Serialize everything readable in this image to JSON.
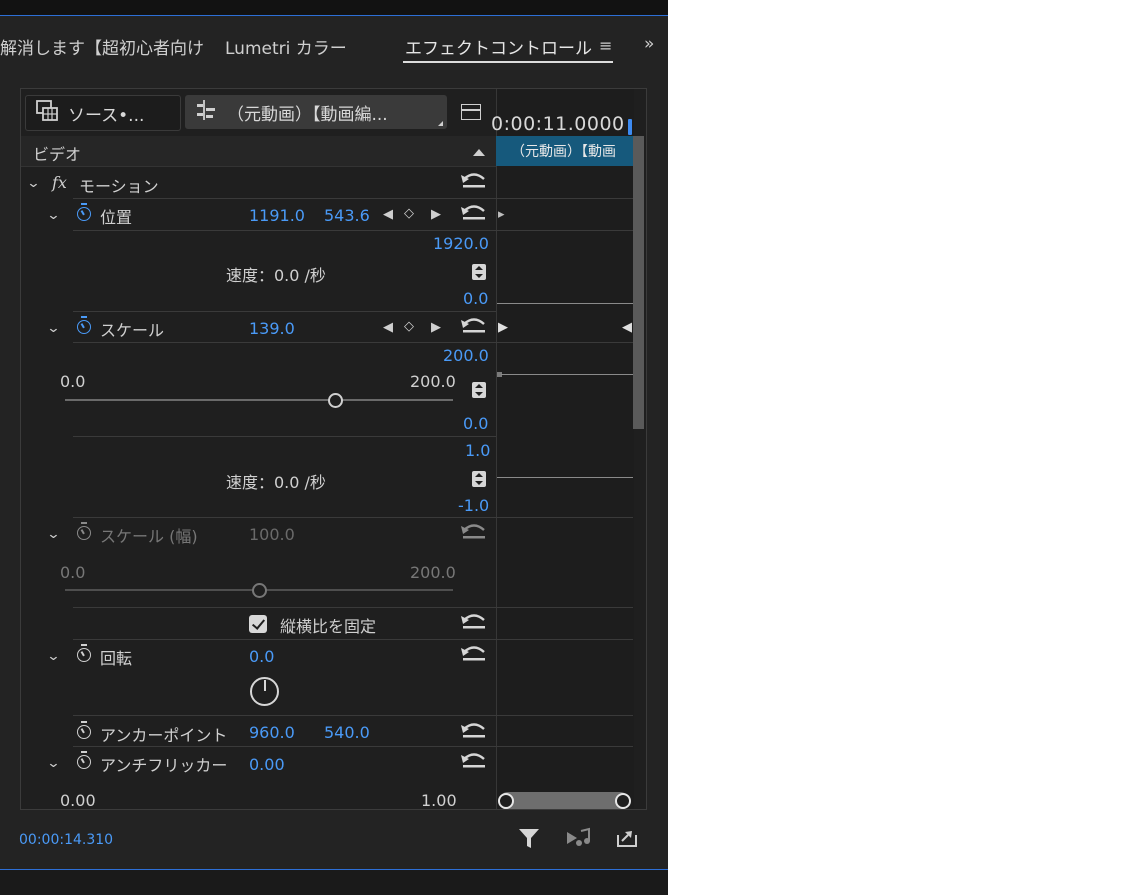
{
  "tabs": [
    {
      "label": "解消します【超初心者向け",
      "active": false
    },
    {
      "label": "Lumetri カラー",
      "active": false
    },
    {
      "label": "エフェクトコントロール",
      "active": true
    }
  ],
  "tab_menu_icon": "hamburger-icon",
  "tab_overflow_icon": "chevron-double-right-icon",
  "source_chip": "ソース•...",
  "sequence_chip": "（元動画）【動画編...",
  "timeline": {
    "timecode": "0:00:11.0000",
    "clip_label": "（元動画）【動画"
  },
  "section": {
    "label": "ビデオ"
  },
  "motion": {
    "label": "モーション",
    "fx": "fx"
  },
  "position": {
    "label": "位置",
    "x": "1191.0",
    "y": "543.6",
    "graph_max": "1920.0",
    "graph_min": "0.0",
    "velocity": "速度：0.0 /秒"
  },
  "scale": {
    "label": "スケール",
    "value": "139.0",
    "graph_max": "200.0",
    "graph_min": "0.0",
    "slider_min": "0.0",
    "slider_max": "200.0",
    "slider_level": 0.695,
    "vel_max": "1.0",
    "vel_min": "-1.0",
    "velocity": "速度：0.0 /秒"
  },
  "scale_width": {
    "label": "スケール (幅)",
    "value": "100.0",
    "slider_min": "0.0",
    "slider_max": "200.0",
    "slider_level": 0.5
  },
  "uniform_scale": {
    "label": "縦横比を固定",
    "checked": true
  },
  "rotation": {
    "label": "回転",
    "value": "0.0"
  },
  "anchor": {
    "label": "アンカーポイント",
    "x": "960.0",
    "y": "540.0"
  },
  "antiflicker": {
    "label": "アンチフリッカー",
    "value": "0.00",
    "min": "0.00",
    "max": "1.00"
  },
  "footer": {
    "timecode": "00:00:14.310"
  },
  "colors": {
    "accent": "#4a9af7",
    "clip": "#16597c",
    "panel": "#232323"
  }
}
